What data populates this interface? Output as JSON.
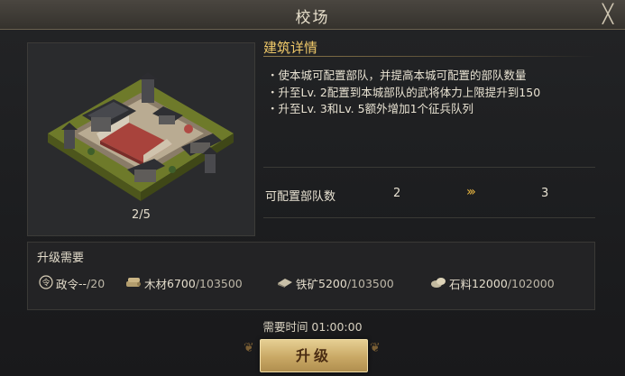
{
  "window": {
    "title": "校场",
    "close_glyph": "╳"
  },
  "building": {
    "level_text": "2/5",
    "image_icon": "drill-ground-building"
  },
  "details": {
    "heading": "建筑详情",
    "lines": [
      "・使本城可配置部队，并提高本城可配置的部队数量",
      "・升至Lv. 2配置到本城部队的武将体力上限提升到150",
      "・升至Lv. 3和Lv. 5额外增加1个征兵队列"
    ],
    "stat": {
      "label": "可配置部队数",
      "current": "2",
      "arrow": "›››",
      "next": "3"
    }
  },
  "requirements": {
    "title": "升级需要",
    "items": [
      {
        "name": "政令",
        "current": "--",
        "max": "/20",
        "icon": "decree-icon"
      },
      {
        "name": "木材",
        "current": "6700",
        "max": "/103500",
        "icon": "wood-icon"
      },
      {
        "name": "铁矿",
        "current": "5200",
        "max": "/103500",
        "icon": "iron-ore-icon"
      },
      {
        "name": "石料",
        "current": "12000",
        "max": "/102000",
        "icon": "stone-icon"
      }
    ]
  },
  "time": {
    "text": "需要时间 01:00:00"
  },
  "upgrade_button": {
    "label": "升级"
  },
  "colors": {
    "accent_gold": "#f0c969",
    "button_gold": "#c9a865"
  }
}
